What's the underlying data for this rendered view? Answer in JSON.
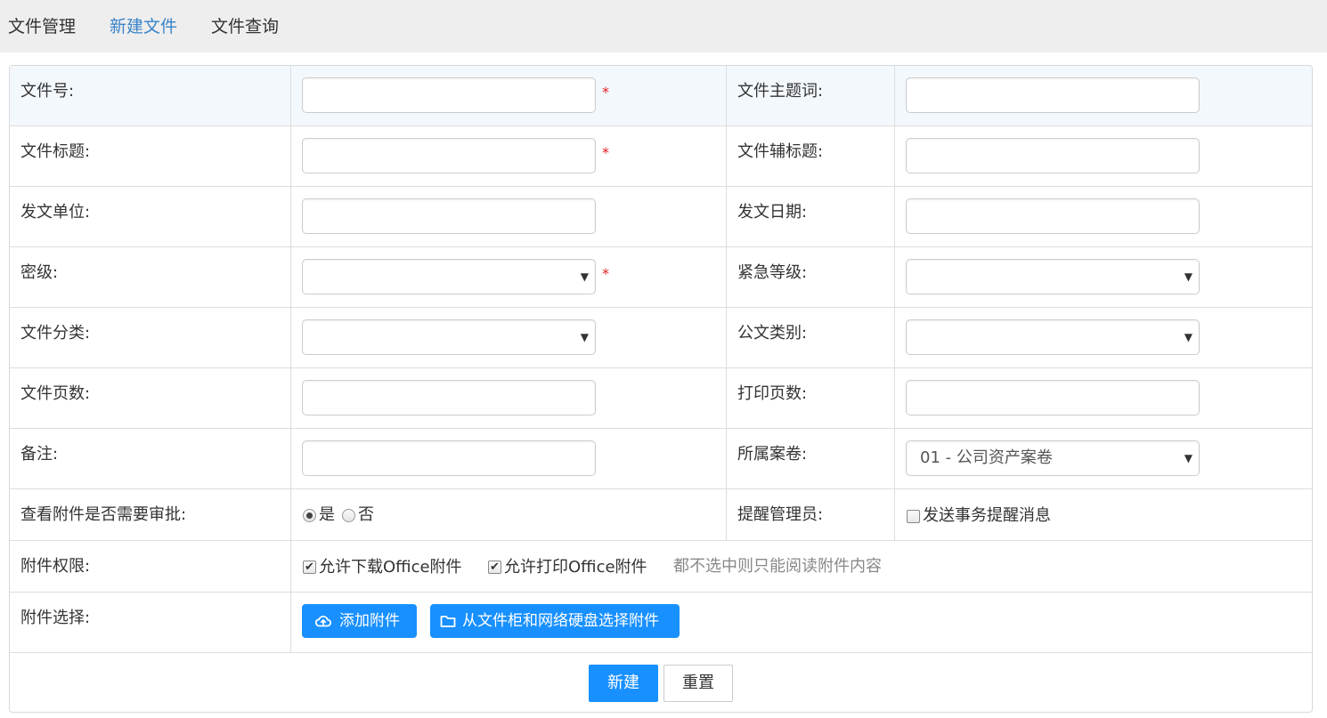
{
  "nav": {
    "items": [
      {
        "label": "文件管理"
      },
      {
        "label": "新建文件"
      },
      {
        "label": "文件查询"
      }
    ],
    "active_color": "#3a84c8"
  },
  "form": {
    "file_no": {
      "label": "文件号:",
      "value": "",
      "required_mark": "*"
    },
    "file_keyword": {
      "label": "文件主题词:",
      "value": ""
    },
    "file_title": {
      "label": "文件标题:",
      "value": "",
      "required_mark": "*"
    },
    "file_subtitle": {
      "label": "文件辅标题:",
      "value": ""
    },
    "issuer": {
      "label": "发文单位:",
      "value": ""
    },
    "issue_date": {
      "label": "发文日期:",
      "value": ""
    },
    "secret_level": {
      "label": "密级:",
      "selected": "",
      "required_mark": "*"
    },
    "urgency": {
      "label": "紧急等级:",
      "selected": ""
    },
    "file_category": {
      "label": "文件分类:",
      "selected": ""
    },
    "doc_type": {
      "label": "公文类别:",
      "selected": ""
    },
    "page_count": {
      "label": "文件页数:",
      "value": ""
    },
    "print_pages": {
      "label": "打印页数:",
      "value": ""
    },
    "remark": {
      "label": "备注:",
      "value": ""
    },
    "archive": {
      "label": "所属案卷:",
      "selected": "01 - 公司资产案卷"
    },
    "approval": {
      "label": "查看附件是否需要审批:",
      "options": [
        {
          "label": "是",
          "checked": true
        },
        {
          "label": "否",
          "checked": false
        }
      ]
    },
    "remind_admin": {
      "label": "提醒管理员:",
      "option_label": "发送事务提醒消息",
      "checked": false
    },
    "attachment_perm": {
      "label": "附件权限:",
      "options": [
        {
          "label": "允许下载Office附件",
          "checked": true
        },
        {
          "label": "允许打印Office附件",
          "checked": true
        }
      ],
      "hint": "都不选中则只能阅读附件内容"
    },
    "attachment_select": {
      "label": "附件选择:",
      "add_button": "添加附件",
      "pick_button": "从文件柜和网络硬盘选择附件"
    }
  },
  "actions": {
    "create": "新建",
    "reset": "重置"
  },
  "colors": {
    "primary": "#1890ff",
    "required": "#e02020",
    "hint": "#888888"
  },
  "icons": {
    "select_caret": "▼",
    "check_mark": "✔",
    "add_attachment": "cloud-upload-icon",
    "pick_attachment": "folder-icon"
  }
}
